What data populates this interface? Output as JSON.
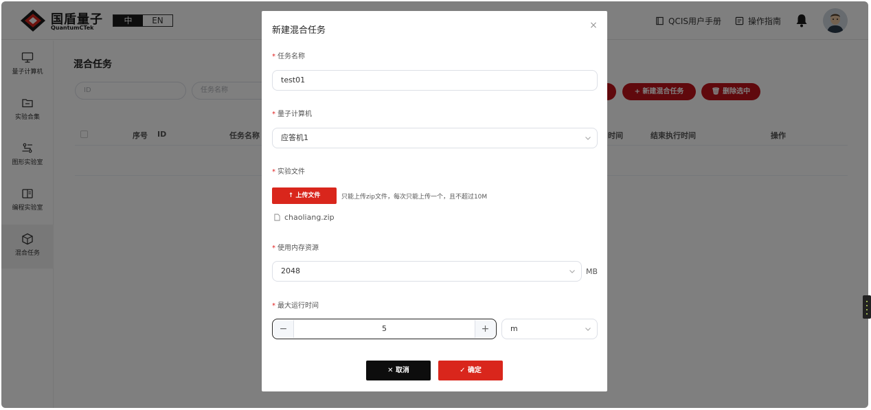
{
  "header": {
    "logo_cn": "国盾量子",
    "logo_en": "QuantumCTek",
    "lang_zh": "中",
    "lang_en": "EN",
    "manual_link": "QCIS用户手册",
    "guide_link": "操作指南"
  },
  "sidebar": {
    "items": [
      {
        "label": "量子计算机",
        "icon": "monitor-icon"
      },
      {
        "label": "实验合集",
        "icon": "folder-icon"
      },
      {
        "label": "图形实验室",
        "icon": "circuit-icon"
      },
      {
        "label": "编程实验室",
        "icon": "book-icon"
      },
      {
        "label": "混合任务",
        "icon": "cube-icon",
        "active": true
      }
    ]
  },
  "main": {
    "title": "混合任务",
    "filters": {
      "id_placeholder": "ID",
      "name_placeholder": "任务名称"
    },
    "buttons": {
      "new_task": "新建混合任务",
      "delete_selected": "删除选中"
    },
    "table_headers": {
      "index": "序号",
      "id": "ID",
      "name": "任务名称",
      "time": "时间",
      "end_time": "结束执行时间",
      "actions": "操作"
    }
  },
  "modal": {
    "title": "新建混合任务",
    "task_name_label": "任务名称",
    "task_name_value": "test01",
    "computer_label": "量子计算机",
    "computer_value": "应答机1",
    "file_label": "实验文件",
    "upload_button": "上传文件",
    "upload_hint": "只能上传zip文件，每次只能上传一个，且不超过10M",
    "file_name": "chaoliang.zip",
    "memory_label": "使用内存资源",
    "memory_value": "2048",
    "memory_unit": "MB",
    "runtime_label": "最大运行时间",
    "runtime_value": "5",
    "runtime_unit": "m",
    "cancel_button": "取消",
    "ok_button": "确定"
  },
  "colors": {
    "brand_red": "#d9261c",
    "dark_red": "#c0121a",
    "overlay": "rgba(0,0,0,0.5)"
  }
}
